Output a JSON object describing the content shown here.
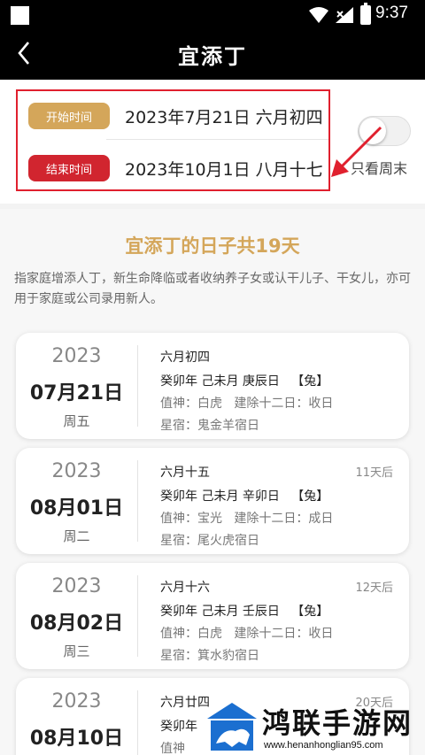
{
  "status_bar": {
    "time": "9:37"
  },
  "nav": {
    "title": "宜添丁"
  },
  "date_range": {
    "start_label": "开始时间",
    "start_value": "2023年7月21日 六月初四",
    "end_label": "结束时间",
    "end_value": "2023年10月1日 八月十七"
  },
  "weekend_toggle": {
    "label": "只看周末",
    "enabled": false
  },
  "summary": {
    "title": "宜添丁的日子共19天",
    "description": "指家庭增添人丁，新生命降临或者收纳养子女或认干儿子、干女儿，亦可用于家庭或公司录用新人。"
  },
  "days": [
    {
      "year": "2023",
      "date": "07月21日",
      "weekday": "周五",
      "lunar": "六月初四",
      "after": "",
      "ganzhi": "癸卯年 己未月 庚辰日   【兔】",
      "zhishen": "值神：白虎   建除十二日：收日",
      "xingxiu": "星宿：鬼金羊宿日"
    },
    {
      "year": "2023",
      "date": "08月01日",
      "weekday": "周二",
      "lunar": "六月十五",
      "after": "11天后",
      "ganzhi": "癸卯年 己未月 辛卯日   【兔】",
      "zhishen": "值神：宝光   建除十二日：成日",
      "xingxiu": "星宿：尾火虎宿日"
    },
    {
      "year": "2023",
      "date": "08月02日",
      "weekday": "周三",
      "lunar": "六月十六",
      "after": "12天后",
      "ganzhi": "癸卯年 己未月 壬辰日   【兔】",
      "zhishen": "值神：白虎   建除十二日：收日",
      "xingxiu": "星宿：箕水豹宿日"
    },
    {
      "year": "2023",
      "date": "08月10日",
      "weekday": "",
      "lunar": "六月廿四",
      "after": "20天后",
      "ganzhi": "癸卯年",
      "zhishen": "值神",
      "xingxiu": ""
    }
  ],
  "watermark": {
    "title": "鸿联手游网",
    "url": "www.henanhonglian95.com"
  },
  "colors": {
    "gold": "#d4a65a",
    "red": "#d1252f",
    "highlight": "#e0202e"
  }
}
